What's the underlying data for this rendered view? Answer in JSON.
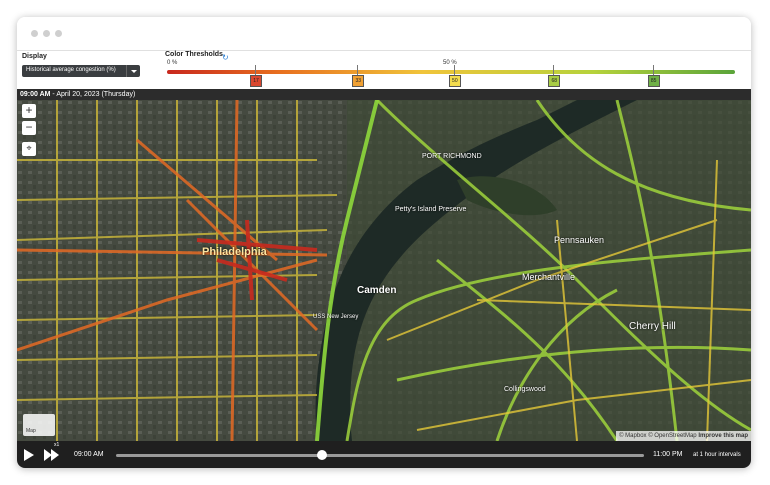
{
  "display": {
    "label": "Display",
    "selected": "Historical average congestion (%)"
  },
  "thresholds": {
    "label": "Color Thresholds",
    "refresh_icon": "refresh-icon",
    "scale_min": "0 %",
    "scale_mid": "50 %",
    "markers": [
      {
        "value": "17",
        "pct": 0.155,
        "color": "#d9472f"
      },
      {
        "value": "33",
        "pct": 0.335,
        "color": "#f0a032"
      },
      {
        "value": "50",
        "pct": 0.505,
        "color": "#f3dc4e"
      },
      {
        "value": "68",
        "pct": 0.68,
        "color": "#a8cc44"
      },
      {
        "value": "85",
        "pct": 0.855,
        "color": "#6fb046"
      }
    ]
  },
  "map": {
    "time": "09:00 AM",
    "date_suffix": " - April 20, 2023 (Thursday)",
    "labels": {
      "philadelphia": "Philadelphia",
      "camden": "Camden",
      "pennsauken": "Pennsauken",
      "merchantville": "Merchantville",
      "cherry_hill": "Cherry Hill",
      "petty_island": "Petty's Island Preserve",
      "port_richmond": "PORT RICHMOND",
      "collingswood": "Collingswood",
      "uss_new_jersey": "USS New Jersey",
      "mapbox_logo": "Map"
    },
    "attribution": "© Mapbox © OpenStreetMap",
    "improve": "Improve this map",
    "zoom_in": "+",
    "zoom_out": "−"
  },
  "player": {
    "start_time": "09:00 AM",
    "end_time": "11:00 PM",
    "interval": "at 1 hour intervals",
    "speed_label": "x1",
    "progress": 0.39
  },
  "colors": {
    "congestion_red": "#c8281e",
    "congestion_orange": "#e8701f",
    "congestion_yellow": "#f0c43a",
    "congestion_green": "#5aa43a"
  }
}
